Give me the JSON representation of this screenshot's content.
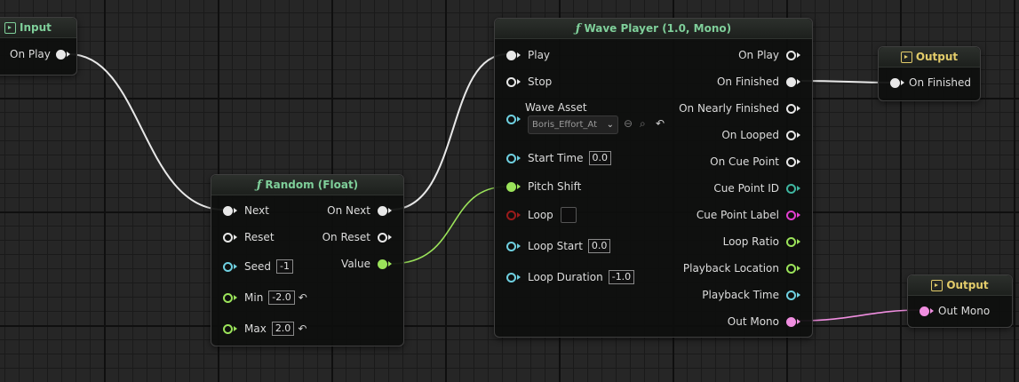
{
  "nodes": {
    "input": {
      "title": "Input",
      "pins": {
        "on_play": "On Play"
      }
    },
    "random": {
      "title": "Random (Float)",
      "inputs": {
        "next": "Next",
        "reset": "Reset",
        "seed": "Seed",
        "min": "Min",
        "max": "Max"
      },
      "values": {
        "seed": "-1",
        "min": "-2.0",
        "max": "2.0"
      },
      "outputs": {
        "on_next": "On Next",
        "on_reset": "On Reset",
        "value": "Value"
      }
    },
    "wave_player": {
      "title": "Wave Player (1.0, Mono)",
      "inputs": {
        "play": "Play",
        "stop": "Stop",
        "wave_asset": "Wave Asset",
        "start_time": "Start Time",
        "pitch_shift": "Pitch Shift",
        "loop": "Loop",
        "loop_start": "Loop Start",
        "loop_duration": "Loop Duration"
      },
      "values": {
        "wave_asset": "Boris_Effort_At",
        "start_time": "0.0",
        "loop_start": "0.0",
        "loop_duration": "-1.0"
      },
      "outputs": {
        "on_play": "On Play",
        "on_finished": "On Finished",
        "on_nearly_finished": "On Nearly Finished",
        "on_looped": "On Looped",
        "on_cue_point": "On Cue Point",
        "cue_point_id": "Cue Point ID",
        "cue_point_label": "Cue Point Label",
        "loop_ratio": "Loop Ratio",
        "playback_location": "Playback Location",
        "playback_time": "Playback Time",
        "out_mono": "Out Mono"
      }
    },
    "output_finished": {
      "title": "Output",
      "pin": "On Finished"
    },
    "output_mono": {
      "title": "Output",
      "pin": "Out Mono"
    }
  },
  "colors": {
    "exec_wire": "#e8e8e8",
    "float_wire": "#9be35a",
    "audio_wire": "#f08ee0",
    "function_header": "#7fcf9a",
    "io_header": "#e3cc6a"
  },
  "icons": {
    "function": "function-f-icon",
    "input": "input-arrow-icon",
    "output": "output-arrow-icon",
    "reset": "reset-arrow-icon"
  }
}
